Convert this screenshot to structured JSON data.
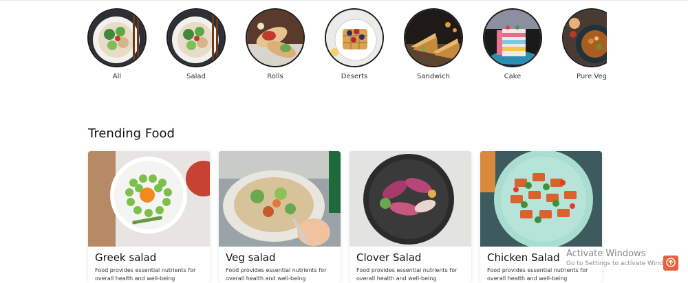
{
  "categories": [
    {
      "label": "All",
      "icon": "salad-bowl-image"
    },
    {
      "label": "Salad",
      "icon": "salad-bowl-image"
    },
    {
      "label": "Rolls",
      "icon": "wrap-rolls-image"
    },
    {
      "label": "Deserts",
      "icon": "waffle-dessert-image"
    },
    {
      "label": "Sandwich",
      "icon": "sandwich-image"
    },
    {
      "label": "Cake",
      "icon": "layer-cake-image"
    },
    {
      "label": "Pure Veg",
      "icon": "veg-curry-image"
    }
  ],
  "trending": {
    "title": "Trending Food",
    "cards": [
      {
        "name": "Greek salad",
        "desc": "Food provides essential nutrients for overall health and well-being",
        "image": "greek-salad-image"
      },
      {
        "name": "Veg salad",
        "desc": "Food provides essential nutrients for overall health and well-being",
        "image": "veg-salad-image"
      },
      {
        "name": "Clover Salad",
        "desc": "Food provides essential nutrients for overall health and well-being",
        "image": "clover-salad-image"
      },
      {
        "name": "Chicken Salad",
        "desc": "Food provides essential nutrients for overall health and well-being",
        "image": "chicken-salad-image"
      }
    ]
  },
  "watermark": {
    "title": "Activate Windows",
    "subtitle": "Go to Settings to activate Windows."
  },
  "colors": {
    "scroll_button": "#e8613a",
    "circle_border": "#1a1a1a"
  }
}
